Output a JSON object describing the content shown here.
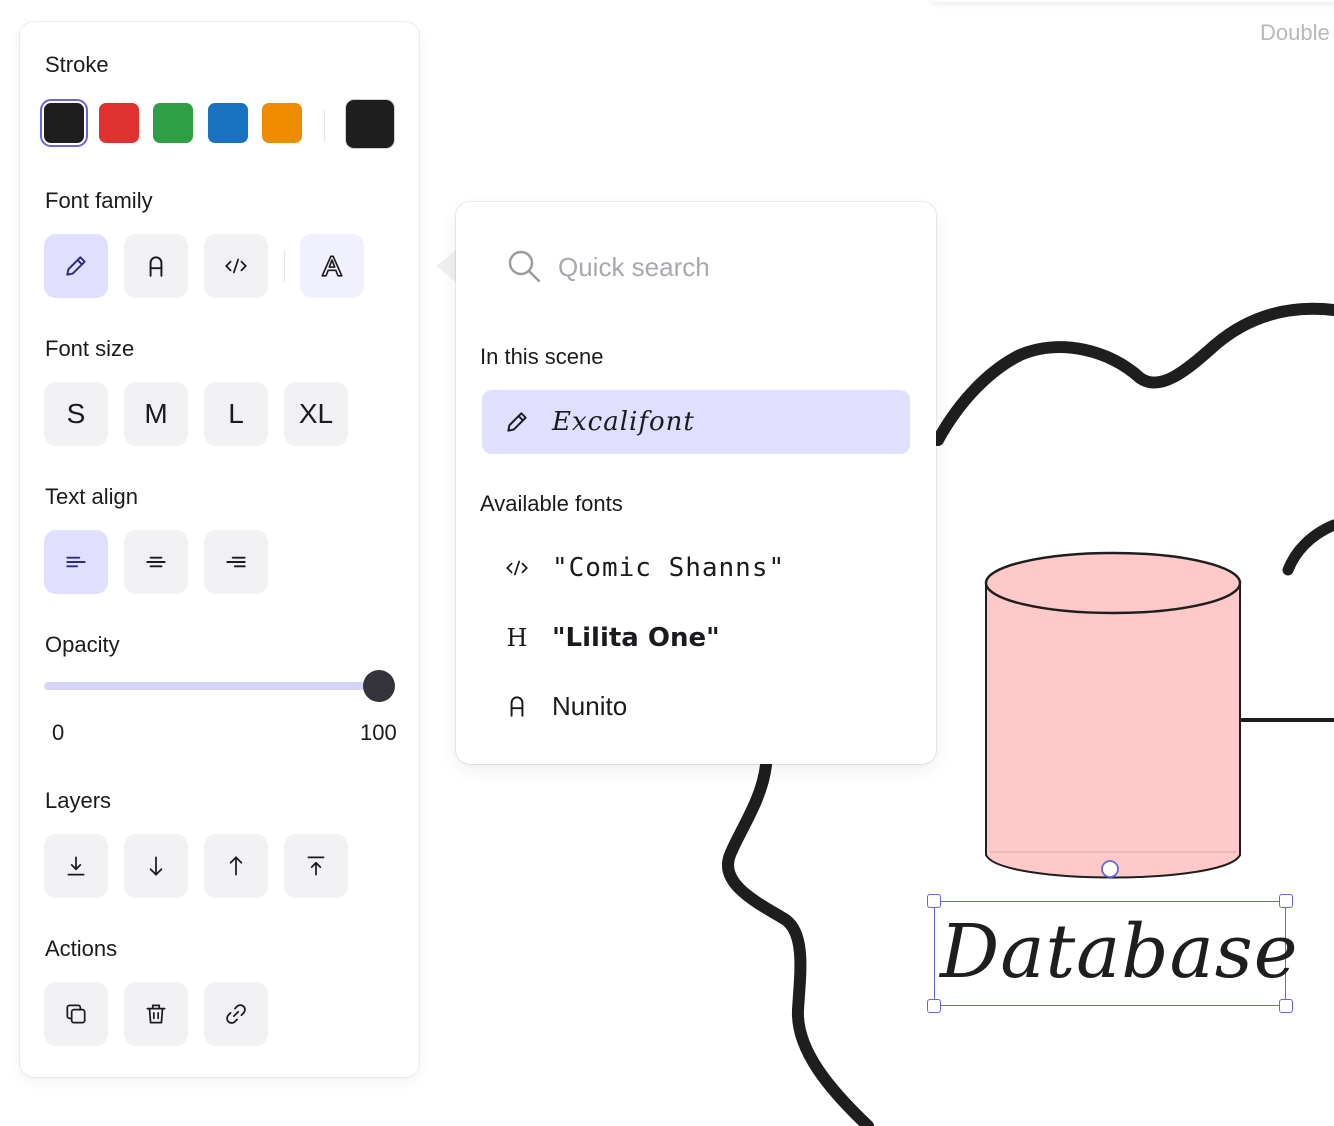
{
  "canvas": {
    "hint_text": "Double"
  },
  "panel": {
    "stroke": {
      "label": "Stroke",
      "colors": [
        "#1e1e1e",
        "#e03131",
        "#2f9e44",
        "#1971c2",
        "#f08c00"
      ],
      "current_color": "#1e1e1e"
    },
    "font_family": {
      "label": "Font family",
      "options": [
        "hand-drawn",
        "normal",
        "code",
        "more-fonts"
      ],
      "selected": "hand-drawn"
    },
    "font_size": {
      "label": "Font size",
      "options": [
        "S",
        "M",
        "L",
        "XL"
      ]
    },
    "text_align": {
      "label": "Text align",
      "options": [
        "left",
        "center",
        "right"
      ],
      "selected": "left"
    },
    "opacity": {
      "label": "Opacity",
      "min": "0",
      "max": "100",
      "value": 100
    },
    "layers": {
      "label": "Layers",
      "options": [
        "send-to-back",
        "send-backward",
        "bring-forward",
        "bring-to-front"
      ]
    },
    "actions": {
      "label": "Actions",
      "options": [
        "duplicate",
        "delete",
        "link"
      ]
    }
  },
  "font_picker": {
    "search_placeholder": "Quick search",
    "in_scene_label": "In this scene",
    "in_scene": [
      {
        "icon": "pencil-icon",
        "name": "Excalifont",
        "selected": true
      }
    ],
    "available_label": "Available fonts",
    "available": [
      {
        "icon": "code-icon",
        "icon_glyph": "</>",
        "name": "\"Comic Shanns\""
      },
      {
        "icon": "heading-icon",
        "icon_glyph": "H",
        "name": "\"Lilita One\""
      },
      {
        "icon": "font-a-icon",
        "icon_glyph": "A",
        "name": "Nunito"
      }
    ]
  },
  "element": {
    "text": "Database",
    "fill_color": "#ffc9c9",
    "stroke_color": "#1e1e1e",
    "selection_color": "#6965db"
  }
}
